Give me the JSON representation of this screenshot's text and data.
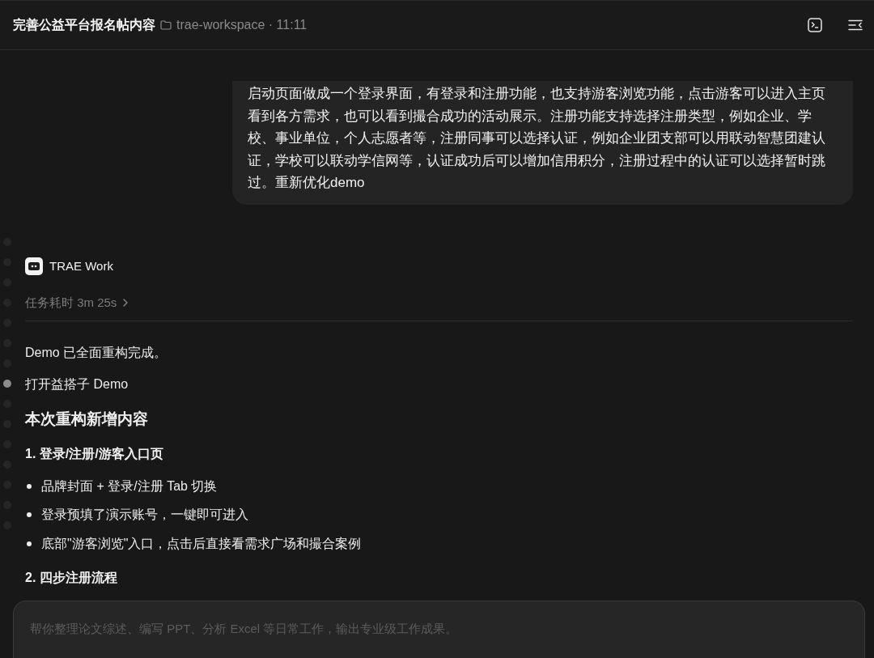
{
  "header": {
    "title": "完善公益平台报名帖内容",
    "workspace": "trae-workspace · 11:11"
  },
  "conversation": {
    "user_message": "启动页面做成一个登录界面，有登录和注册功能，也支持游客浏览功能，点击游客可以进入主页看到各方需求，也可以看到撮合成功的活动展示。注册功能支持选择注册类型，例如企业、学校、事业单位，个人志愿者等，注册同事可以选择认证，例如企业团支部可以用联动智慧团建认证，学校可以联动学信网等，认证成功后可以增加信用积分，注册过程中的认证可以选择暂时跳过。重新优化demo",
    "nav_dots": [
      {
        "selected": false
      },
      {
        "selected": false
      },
      {
        "selected": false
      },
      {
        "selected": false
      },
      {
        "selected": false
      },
      {
        "selected": false
      },
      {
        "selected": false
      },
      {
        "selected": true
      },
      {
        "selected": false
      },
      {
        "selected": false
      },
      {
        "selected": false
      },
      {
        "selected": false
      },
      {
        "selected": false
      },
      {
        "selected": false
      },
      {
        "selected": false
      }
    ],
    "assistant": {
      "name": "TRAE Work",
      "duration": {
        "label": "任务耗时 3m 25s",
        "expanded": false
      },
      "blocks": [
        {
          "kind": "paragraph",
          "text": "Demo 已全面重构完成。"
        },
        {
          "kind": "paragraph",
          "text": "打开益搭子 Demo"
        },
        {
          "kind": "heading",
          "text": "本次重构新增内容"
        },
        {
          "kind": "subheading",
          "text": "1. 登录/注册/游客入口页"
        },
        {
          "kind": "bullets",
          "items": [
            "品牌封面 + 登录/注册 Tab 切换",
            "登录预填了演示账号，一键即可进入",
            "底部\"游客浏览\"入口，点击后直接看需求广场和撮合案例"
          ]
        },
        {
          "kind": "subheading",
          "text": "2. 四步注册流程"
        }
      ]
    }
  },
  "composer": {
    "placeholder": "帮你整理论文综述、编写 PPT、分析 Excel 等日常工作，输出专业级工作成果。"
  }
}
